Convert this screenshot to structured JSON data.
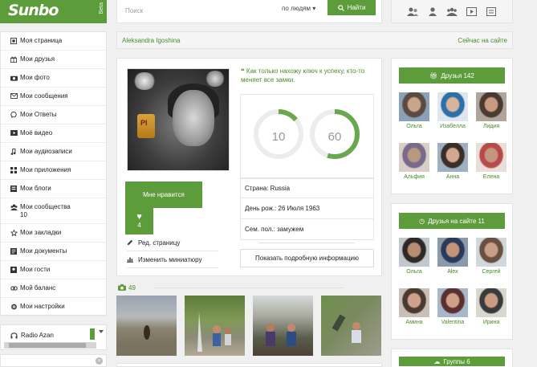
{
  "header": {
    "logo_text": "Sunbo",
    "logo_tag": "Beta",
    "search_placeholder": "Поиск",
    "search_scope": "по людям ▾",
    "search_button": "Найти",
    "icons": [
      "users-icon",
      "user-group-icon",
      "communities-icon",
      "video-icon",
      "news-icon"
    ]
  },
  "sidebar": {
    "items": [
      {
        "label": "Моя страница",
        "icon": "home-icon"
      },
      {
        "label": "Мои друзья",
        "icon": "gift-icon"
      },
      {
        "label": "Мои фото",
        "icon": "camera-icon"
      },
      {
        "label": "Мои сообщения",
        "icon": "envelope-icon"
      },
      {
        "label": "Мои Ответы",
        "icon": "comment-icon"
      },
      {
        "label": "Моё видео",
        "icon": "video-icon"
      },
      {
        "label": "Мои аудиозаписи",
        "icon": "music-icon"
      },
      {
        "label": "Мои приложения",
        "icon": "apps-icon"
      },
      {
        "label": "Мои блоги",
        "icon": "blog-icon"
      },
      {
        "label": "Мои сообщества",
        "sub": "10",
        "icon": "community-icon"
      },
      {
        "label": "Мои закладки",
        "icon": "star-icon"
      },
      {
        "label": "Мои документы",
        "icon": "document-icon"
      },
      {
        "label": "Мои гости",
        "icon": "guests-icon"
      },
      {
        "label": "Мой баланс",
        "icon": "balance-icon"
      },
      {
        "label": "Мои настройки",
        "icon": "settings-icon"
      }
    ]
  },
  "player": {
    "title": "Radio Azan"
  },
  "profile": {
    "name": "Aleksandra Igoshina",
    "online_status": "Сейчас на сайте",
    "quote": "Как только нахожу ключ к успеху, кто-то меняет все замки.",
    "ring_left": "10",
    "ring_right": "60",
    "ring_left_fraction": 0.14,
    "ring_right_fraction": 0.55,
    "avatar_badge": "PI",
    "info": [
      {
        "label": "Страна:",
        "value": "Russia"
      },
      {
        "label": "День рож.:",
        "value": "26 Июля 1963"
      },
      {
        "label": "Сем. пол.:",
        "value": "замужем"
      }
    ],
    "more_button": "Показать подробную информацию",
    "like_button": "Мне нравится",
    "like_count": "4",
    "edit_page": "Ред. страницу",
    "change_thumbnail": "Изменить миниатюру",
    "photos_count": "49"
  },
  "friends": {
    "button": "Друзья 142",
    "list": [
      {
        "name": "Ольга"
      },
      {
        "name": "Изабелла"
      },
      {
        "name": "Лидия"
      },
      {
        "name": "Альфия"
      },
      {
        "name": "Анна"
      },
      {
        "name": "Елена"
      }
    ]
  },
  "friends_online": {
    "button": "Друзья на сайте 11",
    "list": [
      {
        "name": "Ольга"
      },
      {
        "name": "Alex"
      },
      {
        "name": "Сергей"
      },
      {
        "name": "Амина"
      },
      {
        "name": "Valentina"
      },
      {
        "name": "Ирина"
      }
    ]
  },
  "groups": {
    "button": "Группы 6"
  },
  "colors": {
    "accent": "#5d9c3a",
    "link": "#4a8c2a"
  }
}
